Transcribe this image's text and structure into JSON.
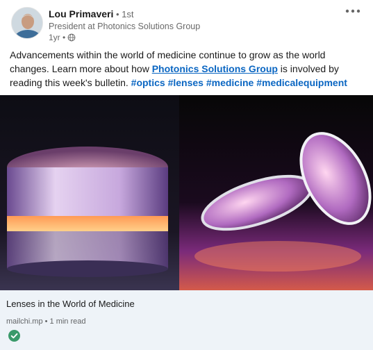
{
  "author": {
    "name": "Lou Primaveri",
    "degree": " • 1st",
    "headline": "President at Photonics Solutions Group",
    "time": "1yr •"
  },
  "icons": {
    "avatar": "profile-photo",
    "visibility": "globe-icon",
    "menu": "more-dots-icon",
    "verified": "check-circle-icon"
  },
  "post": {
    "text_part1": "Advancements within the world of medicine continue to grow as the world changes. Learn more about how ",
    "company_link": "Photonics Solutions Group",
    "text_part2": " is involved by reading this week's bulletin. ",
    "hashtags": [
      "#optics",
      "#lenses",
      "#medicine",
      "#medicalequipment"
    ]
  },
  "card": {
    "title": "Lenses in the World of Medicine",
    "meta": "mailchi.mp • 1 min read"
  },
  "colors": {
    "link": "#0a66c2",
    "card_bg": "#eef3f8",
    "check": "#057642"
  }
}
